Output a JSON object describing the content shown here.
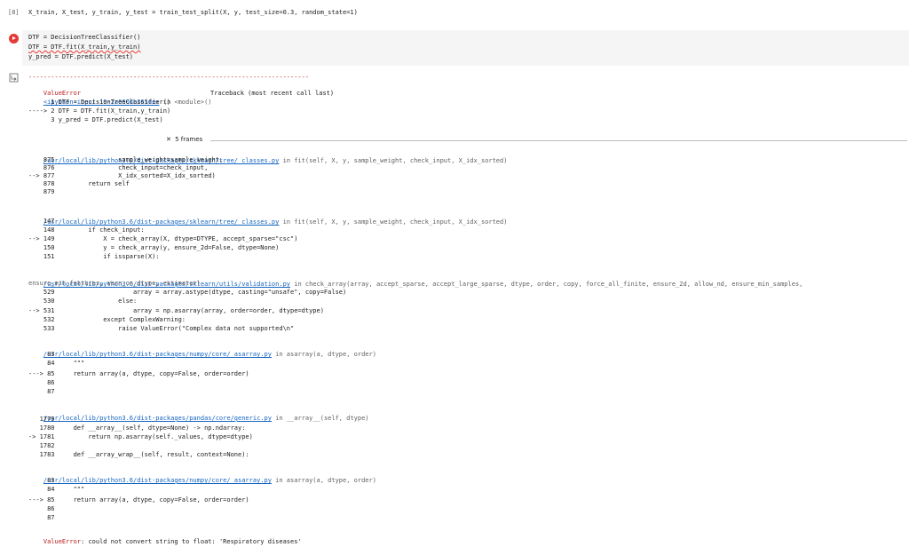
{
  "cell8": {
    "prompt": "[8]",
    "code": "X_train, X_test, y_train, y_test = train_test_split(X, y, test_size=0.3, random_state=1)"
  },
  "cell9": {
    "lines": [
      "DTF = DecisionTreeClassifier()",
      "DTF = DTF.fit(X_train,y_train)",
      "y_pred = DTF.predict(X_test)"
    ]
  },
  "traceback": {
    "rule": "---------------------------------------------------------------------------",
    "error_name": "ValueError",
    "header": "Traceback (most recent call last)",
    "input_link": "<ipython-input-19-2a060db265de>",
    "input_in": " in <module>()",
    "input_lines": [
      "      1 DTF = DecisionTreeClassifier()",
      "----> 2 DTF = DTF.fit(X_train,y_train)",
      "      3 y_pred = DTF.predict(X_test)"
    ],
    "frames_label": "5 frames",
    "frames": [
      {
        "path": "/usr/local/lib/python3.6/dist-packages/sklearn/tree/_classes.py",
        "sig": " in fit(self, X, y, sample_weight, check_input, X_idx_sorted)",
        "lines": [
          "    875                 sample_weight=sample_weight,",
          "    876                 check_input=check_input,",
          "--> 877                 X_idx_sorted=X_idx_sorted)",
          "    878         return self",
          "    879"
        ]
      },
      {
        "path": "/usr/local/lib/python3.6/dist-packages/sklearn/tree/_classes.py",
        "sig": " in fit(self, X, y, sample_weight, check_input, X_idx_sorted)",
        "lines": [
          "    147",
          "    148         if check_input:",
          "--> 149             X = check_array(X, dtype=DTYPE, accept_sparse=\"csc\")",
          "    150             y = check_array(y, ensure_2d=False, dtype=None)",
          "    151             if issparse(X):"
        ]
      },
      {
        "path": "/usr/local/lib/python3.6/dist-packages/sklearn/utils/validation.py",
        "sig": " in check_array(array, accept_sparse, accept_large_sparse, dtype, order, copy, force_all_finite, ensure_2d, allow_nd, ensure_min_samples,",
        "sig2": "ensure_min_features, warn_on_dtype, estimator)",
        "lines": [
          "    529                     array = array.astype(dtype, casting=\"unsafe\", copy=False)",
          "    530                 else:",
          "--> 531                     array = np.asarray(array, order=order, dtype=dtype)",
          "    532             except ComplexWarning:",
          "    533                 raise ValueError(\"Complex data not supported\\n\""
        ]
      },
      {
        "path": "/usr/local/lib/python3.6/dist-packages/numpy/core/_asarray.py",
        "sig": " in asarray(a, dtype, order)",
        "lines": [
          "     83",
          "     84     \"\"\"",
          "---> 85     return array(a, dtype, copy=False, order=order)",
          "     86",
          "     87"
        ]
      },
      {
        "path": "/usr/local/lib/python3.6/dist-packages/pandas/core/generic.py",
        "sig": " in __array__(self, dtype)",
        "lines": [
          "   1779",
          "   1780     def __array__(self, dtype=None) -> np.ndarray:",
          "-> 1781         return np.asarray(self._values, dtype=dtype)",
          "   1782",
          "   1783     def __array_wrap__(self, result, context=None):"
        ]
      },
      {
        "path": "/usr/local/lib/python3.6/dist-packages/numpy/core/_asarray.py",
        "sig": " in asarray(a, dtype, order)",
        "lines": [
          "     83",
          "     84     \"\"\"",
          "---> 85     return array(a, dtype, copy=False, order=order)",
          "     86",
          "     87"
        ]
      }
    ],
    "final_error_name": "ValueError",
    "final_error_msg": ": could not convert string to float: 'Respiratory diseases'"
  },
  "colors": {
    "run_button": "#e53935",
    "error": "#b71c1c",
    "link": "#1565c0"
  }
}
